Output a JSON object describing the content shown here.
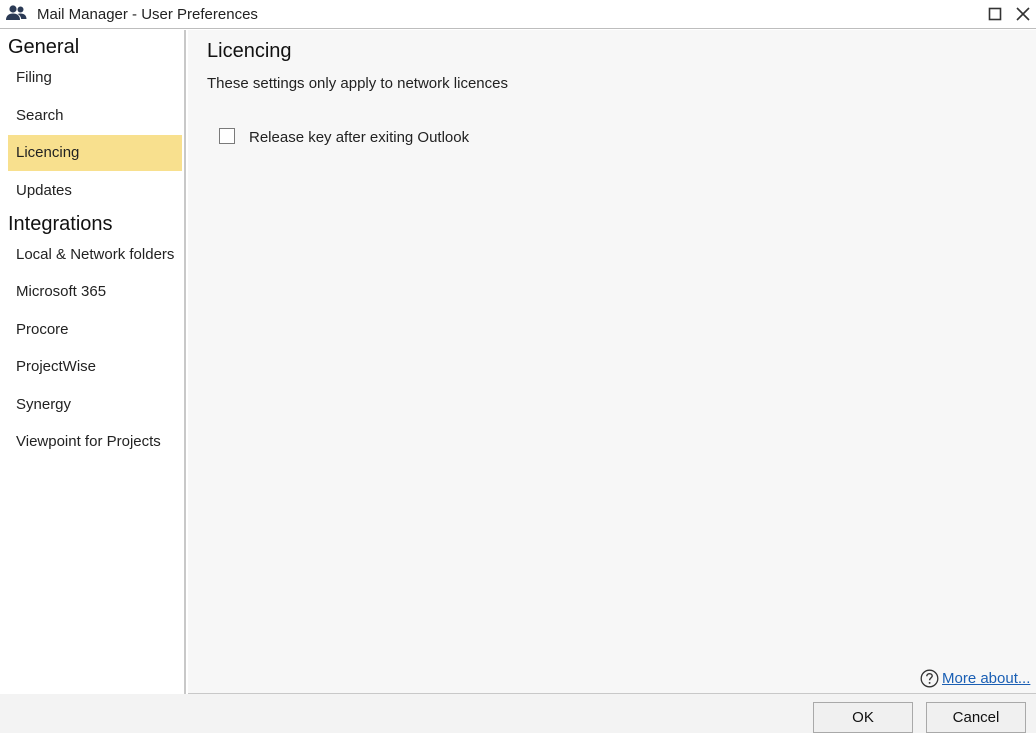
{
  "window": {
    "title": "Mail Manager - User Preferences",
    "icon": "users-icon",
    "controls": [
      "maximize-icon",
      "close-icon"
    ]
  },
  "sidebar": {
    "groups": [
      {
        "heading": "General",
        "items": [
          {
            "label": "Filing",
            "selected": false
          },
          {
            "label": "Search",
            "selected": false
          },
          {
            "label": "Licencing",
            "selected": true
          },
          {
            "label": "Updates",
            "selected": false
          }
        ]
      },
      {
        "heading": "Integrations",
        "items": [
          {
            "label": "Local & Network folders",
            "selected": false
          },
          {
            "label": "Microsoft 365",
            "selected": false
          },
          {
            "label": "Procore",
            "selected": false
          },
          {
            "label": "ProjectWise",
            "selected": false
          },
          {
            "label": "Synergy",
            "selected": false
          },
          {
            "label": "Viewpoint for Projects",
            "selected": false
          }
        ]
      }
    ],
    "selected_color": "#f8e08e"
  },
  "main": {
    "title": "Licencing",
    "description": "These settings only apply to network licences",
    "options": [
      {
        "label": "Release key after exiting Outlook",
        "checked": false
      }
    ],
    "help": {
      "icon": "question-circle-icon",
      "link_text": "More about..."
    }
  },
  "footer": {
    "ok_label": "OK",
    "cancel_label": "Cancel"
  },
  "colors": {
    "accent_selected": "#f8e08e",
    "link": "#1a5fb4",
    "panel_background": "#f7f7f7"
  }
}
